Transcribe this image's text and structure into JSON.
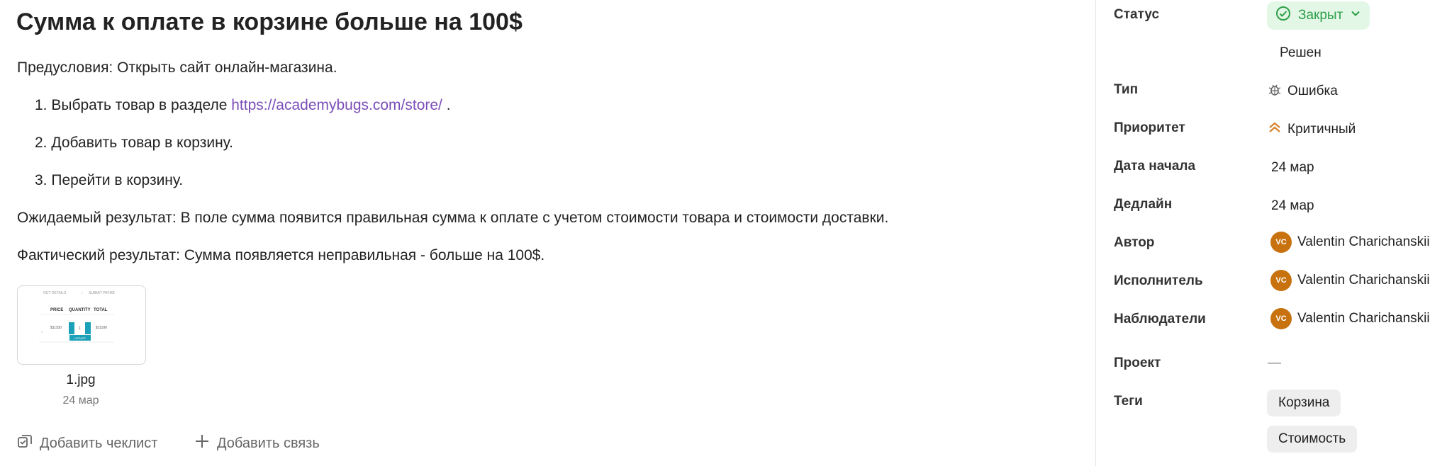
{
  "issue": {
    "title": "Сумма к оплате в корзине больше на 100$",
    "preconditions": "Предусловия: Открыть сайт онлайн-магазина.",
    "steps": [
      {
        "number": "1.",
        "text_before": "Выбрать товар в разделе",
        "link": "https://academybugs.com/store/",
        "text_after": "."
      },
      {
        "number": "2.",
        "text": "Добавить товар в корзину."
      },
      {
        "number": "3.",
        "text": "Перейти в корзину."
      }
    ],
    "expected": "Ожидаемый результат: В поле сумма появится правильная сумма к оплате с учетом стоимости товара и стоимости доставки.",
    "actual": "Фактический результат: Сумма появляется неправильная - больше на 100$."
  },
  "attachment": {
    "name": "1.jpg",
    "date": "24 мар",
    "preview": {
      "tabs": [
        "OUT DETAILS",
        "SUBMIT PAYME"
      ],
      "headers": [
        "PRICE",
        "QUANTITY",
        "TOTAL"
      ],
      "price": "$11100",
      "quantity": "1",
      "total": "$11100",
      "button": "UPDATE"
    }
  },
  "actions": {
    "checklist": "Добавить чеклист",
    "link": "Добавить связь"
  },
  "sidebar": {
    "status": {
      "label": "Статус",
      "value": "Закрыт",
      "resolution": "Решен"
    },
    "type": {
      "label": "Тип",
      "value": "Ошибка"
    },
    "priority": {
      "label": "Приоритет",
      "value": "Критичный"
    },
    "start_date": {
      "label": "Дата начала",
      "value": "24 мар"
    },
    "deadline": {
      "label": "Дедлайн",
      "value": "24 мар"
    },
    "author": {
      "label": "Автор",
      "initials": "VC",
      "name": "Valentin Charichanskii"
    },
    "assignee": {
      "label": "Исполнитель",
      "initials": "VC",
      "name": "Valentin Charichanskii"
    },
    "followers": {
      "label": "Наблюдатели",
      "initials": "VC",
      "name": "Valentin Charichanskii"
    },
    "project": {
      "label": "Проект",
      "value": "—"
    },
    "tags": {
      "label": "Теги",
      "items": [
        "Корзина",
        "Стоимость"
      ]
    }
  },
  "colors": {
    "link": "#7b4db8",
    "status_bg": "#e3f7e6",
    "status_text": "#2d9f49",
    "priority": "#d9822b",
    "avatar": "#c8720f"
  },
  "icons": {
    "status": "check-circle-icon",
    "status_dropdown": "chevron-down-icon",
    "type": "bug-icon",
    "priority": "double-chevron-up-icon",
    "checklist": "checklist-icon",
    "link": "plus-icon"
  }
}
